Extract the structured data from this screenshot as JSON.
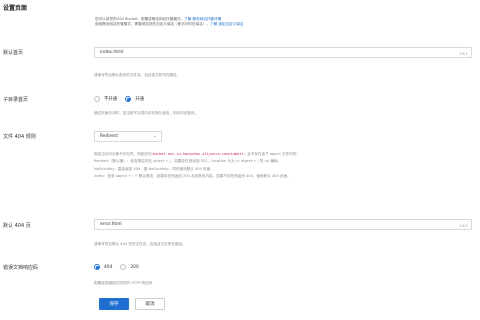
{
  "section_title": "设置页面",
  "info": {
    "line1_prefix": "您可以将您的OSS Bucket，配置成静态网站托管模式。",
    "line1_link": "了解 静态网站托管详情",
    "line2_prefix": "使用静态网站托管模式，需要绑定您的自定义域名（即访问时的域名）。",
    "line2_link": "了解 绑定自定义域名"
  },
  "index_page": {
    "label": "默认首页",
    "value": "index.html",
    "counter": "10/1",
    "help": "请填写符合默认首页的文件名，包括该文件所在路径。"
  },
  "subdir_index": {
    "label": "子目录首页",
    "options": [
      "不开通",
      "开通"
    ],
    "selected": "开通",
    "help": "通过页面访问时，如当前子目录中存在默认首页，则访问该首页。"
  },
  "file_404_rule": {
    "label": "文件 404 规则",
    "value": "Redirect",
    "desc": [
      "指定当访问对象不存在时，例如访问 <code>bucket.oss-cn-hangzhou.aliyuncs.com/subdir</code>，且不存在该子 object 文件时的：",
      "Redirect（默认值）：检查是否存在 object + /，如果存在则返回 302，Location 头为 /+ object + / 的 url 编码。",
      "NoSuchKey：直接返回 404，报 NoSuchKey，同时使用默认 404 页面。",
      "Index：检查 object + / + 默认首页，如果存在则返回 200 及该首页内容，如果不存在则返回 404，使用默认 404 页面。"
    ]
  },
  "page_404": {
    "label": "默认 404 页",
    "value": "error.html",
    "counter": "10/1",
    "help": "请填写符合默认 404 页的文件名，包括该文件所在路径。"
  },
  "error_status": {
    "label": "错误文档响应码",
    "options": [
      "404",
      "200"
    ],
    "selected": "404",
    "help": "配置返回错误文档时的 HTTP 响应码"
  },
  "buttons": {
    "save": "保存",
    "cancel": "取消"
  }
}
